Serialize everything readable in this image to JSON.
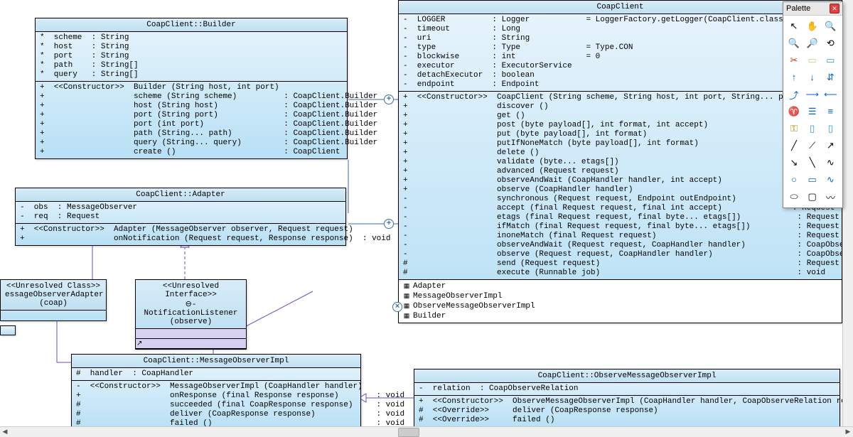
{
  "palette": {
    "title": "Palette",
    "tools": [
      "select-icon",
      "hand-icon",
      "zoom-in-icon",
      "zoom-out-icon",
      "zoom-fit-icon",
      "zoom-100-icon",
      "cut-icon",
      "note-icon",
      "package-icon",
      "arrow-up-icon",
      "arrow-down-icon",
      "arrow-updown-icon",
      "dep-icon",
      "assoc-icon",
      "assoc2-icon",
      "tree-icon",
      "list-icon",
      "list2-icon",
      "key-icon",
      "page-icon",
      "page2-icon",
      "line1-icon",
      "line2-icon",
      "line3-icon",
      "line4-icon",
      "line5-icon",
      "line6-icon",
      "ellipse-icon",
      "rect-icon",
      "poly-icon",
      "oval-icon",
      "roundrect-icon",
      "path-icon"
    ]
  },
  "builder": {
    "title": "CoapClient::Builder",
    "attrs": "*  scheme  : String\n*  host    : String\n*  port    : String\n*  path    : String[]\n*  query   : String[]",
    "ops": "+  <<Constructor>>  Builder (String host, int port)\n+                   scheme (String scheme)          : CoapClient.Builder\n+                   host (String host)              : CoapClient.Builder\n+                   port (String port)              : CoapClient.Builder\n+                   port (int port)                 : CoapClient.Builder\n+                   path (String... path)           : CoapClient.Builder\n+                   query (String... query)         : CoapClient.Builder\n+                   create ()                       : CoapClient"
  },
  "adapter": {
    "title": "CoapClient::Adapter",
    "attrs": "-  obs  : MessageObserver\n-  req  : Request",
    "ops": "+  <<Constructor>>  Adapter (MessageObserver observer, Request request)\n+                   onNotification (Request request, Response response)  : void"
  },
  "unresClass": {
    "stereo": "<<Unresolved Class>>",
    "name": "essageObserverAdapter",
    "pkg": "(coap)"
  },
  "unresIf": {
    "stereo": "<<Unresolved Interface>>",
    "name": "⊖- NotificationListener",
    "pkg": "(observe)"
  },
  "msgObs": {
    "title": "CoapClient::MessageObserverImpl",
    "attrs": "#  handler  : CoapHandler",
    "ops": "-  <<Constructor>>  MessageObserverImpl (CoapHandler handler)\n+                   onResponse (final Response response)        : void\n#                   succeeded (final CoapResponse response)     : void\n#                   deliver (CoapResponse response)             : void\n#                   failed ()                                   : void"
  },
  "obsMsg": {
    "title": "CoapClient::ObserveMessageObserverImpl",
    "attrs": "-  relation  : CoapObserveRelation",
    "ops": "+  <<Constructor>>  ObserveMessageObserverImpl (CoapHandler handler, CoapObserveRelation relation)\n#  <<Override>>     deliver (CoapResponse response)\n#  <<Override>>     failed ()"
  },
  "coapClient": {
    "title": "CoapClient",
    "attrs": "-  LOGGER          : Logger            = LoggerFactory.getLogger(CoapClient.class.getCanon\n-  timeout         : Long\n-  uri             : String\n-  type            : Type              = Type.CON\n-  blockwise       : int               = 0\n-  executor        : ExecutorService\n-  detachExecutor  : boolean\n-  endpoint        : Endpoint",
    "ops": "+  <<Constructor>>  CoapClient (String scheme, String host, int port, String... path)\n+                   discover ()                                                     : S\n+                   get ()                                                          : C\n+                   post (byte payload[], int format, int accept)                   : C\n+                   put (byte payload[], int format)                                : C\n+                   putIfNoneMatch (byte payload[], int format)                     : C\n+                   delete ()                                                       : C\n+                   validate (byte... etags[])                                      : C\n+                   advanced (Request request)                                      : C\n+                   observeAndWait (CoapHandler handler, int accept)                : C\n+                   observe (CoapHandler handler)                                   : C\n-                   synchronous (Request request, Endpoint outEndpoint)             : CoapResponse\n-                   accept (final Request request, final int accept)               : Request\n-                   etags (final Request request, final byte... etags[])            : Request\n-                   ifMatch (final Request request, final byte... etags[])          : Request\n-                   inoneMatch (final Request request)                              : Request\n-                   observeAndWait (Request request, CoapHandler handler)           : CoapObserveRelat\n-                   observe (Request request, CoapHandler handler)                  : CoapObserveRelat\n#                   send (Request request)                                          : Request\n#                   execute (Runnable job)                                          : void",
    "nested": [
      "Adapter",
      "MessageObserverImpl",
      "ObserveMessageObserverImpl",
      "Builder"
    ]
  }
}
